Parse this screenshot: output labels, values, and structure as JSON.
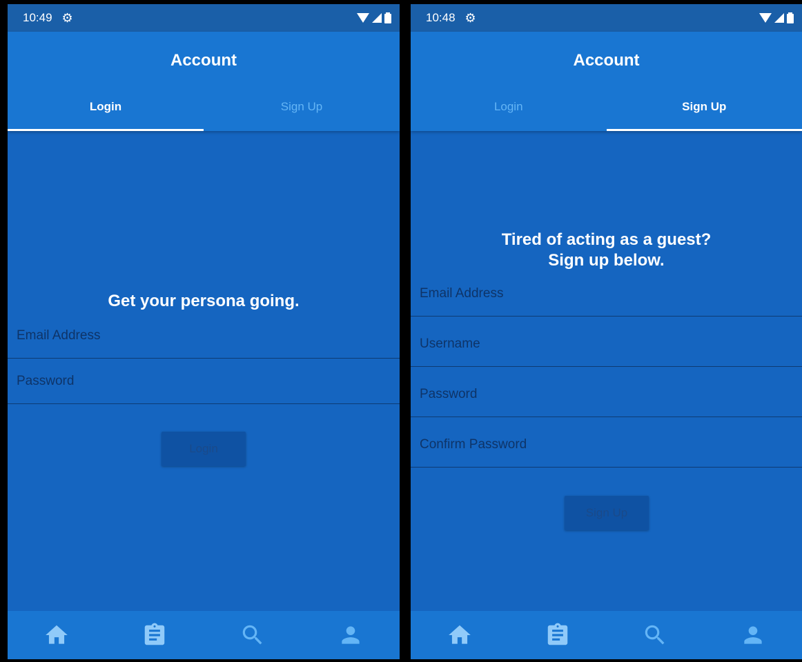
{
  "left": {
    "status": {
      "time": "10:49"
    },
    "appbar": {
      "title": "Account"
    },
    "tabs": [
      {
        "label": "Login",
        "active": true
      },
      {
        "label": "Sign Up",
        "active": false
      }
    ],
    "heading": "Get your persona going.",
    "fields": {
      "email_placeholder": "Email Address",
      "password_placeholder": "Password"
    },
    "button_label": "Login"
  },
  "right": {
    "status": {
      "time": "10:48"
    },
    "appbar": {
      "title": "Account"
    },
    "tabs": [
      {
        "label": "Login",
        "active": false
      },
      {
        "label": "Sign Up",
        "active": true
      }
    ],
    "heading_line1": "Tired of acting as a guest?",
    "heading_line2": "Sign up below.",
    "fields": {
      "email_placeholder": "Email Address",
      "username_placeholder": "Username",
      "password_placeholder": "Password",
      "confirm_placeholder": "Confirm Password"
    },
    "button_label": "Sign Up"
  },
  "navbar": {
    "items": [
      {
        "icon": "home-icon",
        "color": "#90caf9"
      },
      {
        "icon": "clipboard-icon",
        "color": "#90caf9"
      },
      {
        "icon": "search-icon",
        "color": "#64b5f6"
      },
      {
        "icon": "person-icon",
        "color": "#64b5f6"
      }
    ]
  },
  "colors": {
    "background": "#1565c0",
    "appbar": "#1976d2",
    "status_bar": "#1a5fa8",
    "button": "#0f52a3"
  }
}
